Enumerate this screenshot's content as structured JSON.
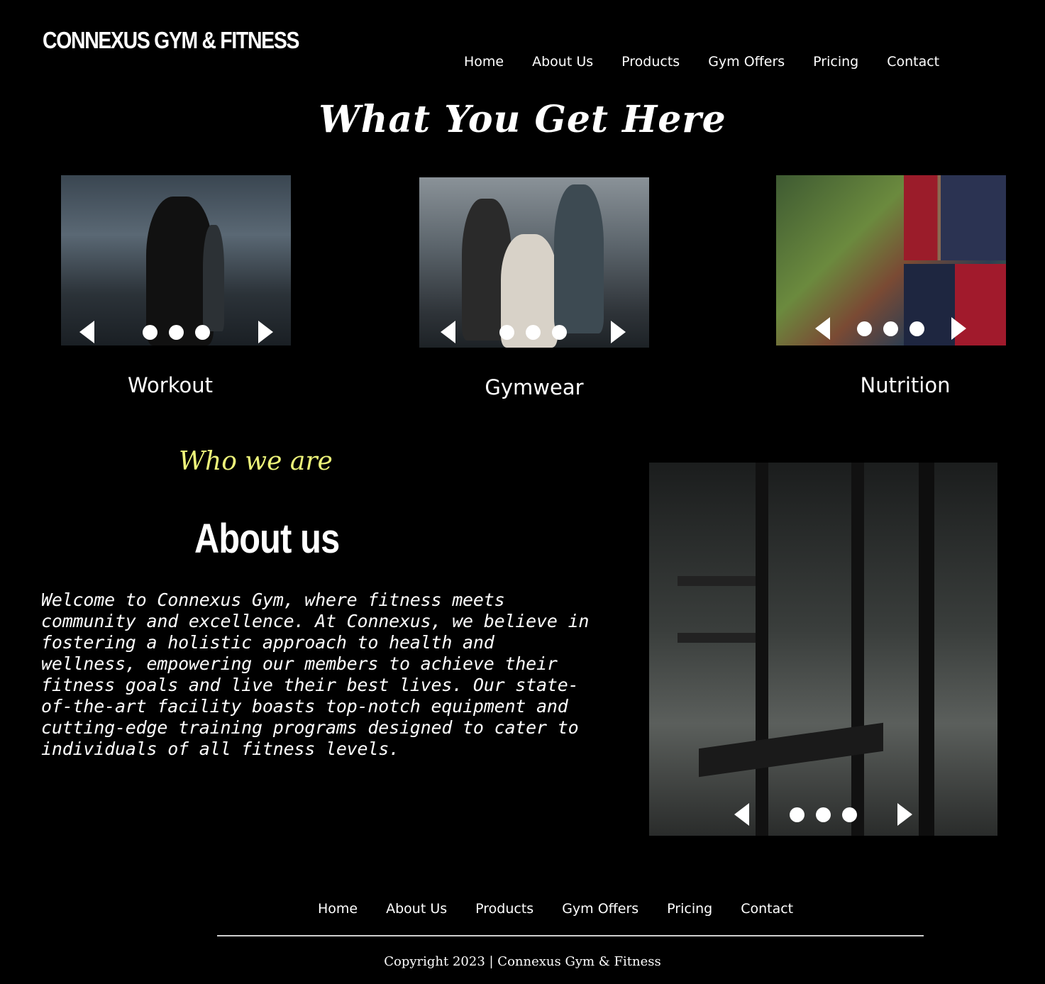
{
  "header": {
    "brand": "CONNEXUS GYM & FITNESS"
  },
  "nav": {
    "items": [
      {
        "label": "Home"
      },
      {
        "label": "About Us"
      },
      {
        "label": "Products"
      },
      {
        "label": "Gym Offers"
      },
      {
        "label": "Pricing"
      },
      {
        "label": "Contact"
      }
    ]
  },
  "services": {
    "headline": "What You Get Here",
    "cards": [
      {
        "label": "Workout",
        "image": "workout-photo"
      },
      {
        "label": "Gymwear",
        "image": "gymwear-photo"
      },
      {
        "label": "Nutrition",
        "image": "nutrition-photo"
      }
    ]
  },
  "about": {
    "eyebrow": "Who we are",
    "title": "About us",
    "body": "Welcome to Connexus Gym, where fitness meets community and excellence. At Connexus, we believe in fostering a holistic approach to health and wellness, empowering our members to achieve their fitness goals and live their best lives. Our state-of-the-art facility boasts top-notch equipment and cutting-edge training programs designed to cater to individuals of all fitness levels.",
    "image": "gym-rack-photo"
  },
  "footer": {
    "copyright": "Copyright 2023 | Connexus Gym & Fitness"
  },
  "colors": {
    "background": "#000000",
    "text": "#ffffff",
    "accent": "#eef57a"
  }
}
